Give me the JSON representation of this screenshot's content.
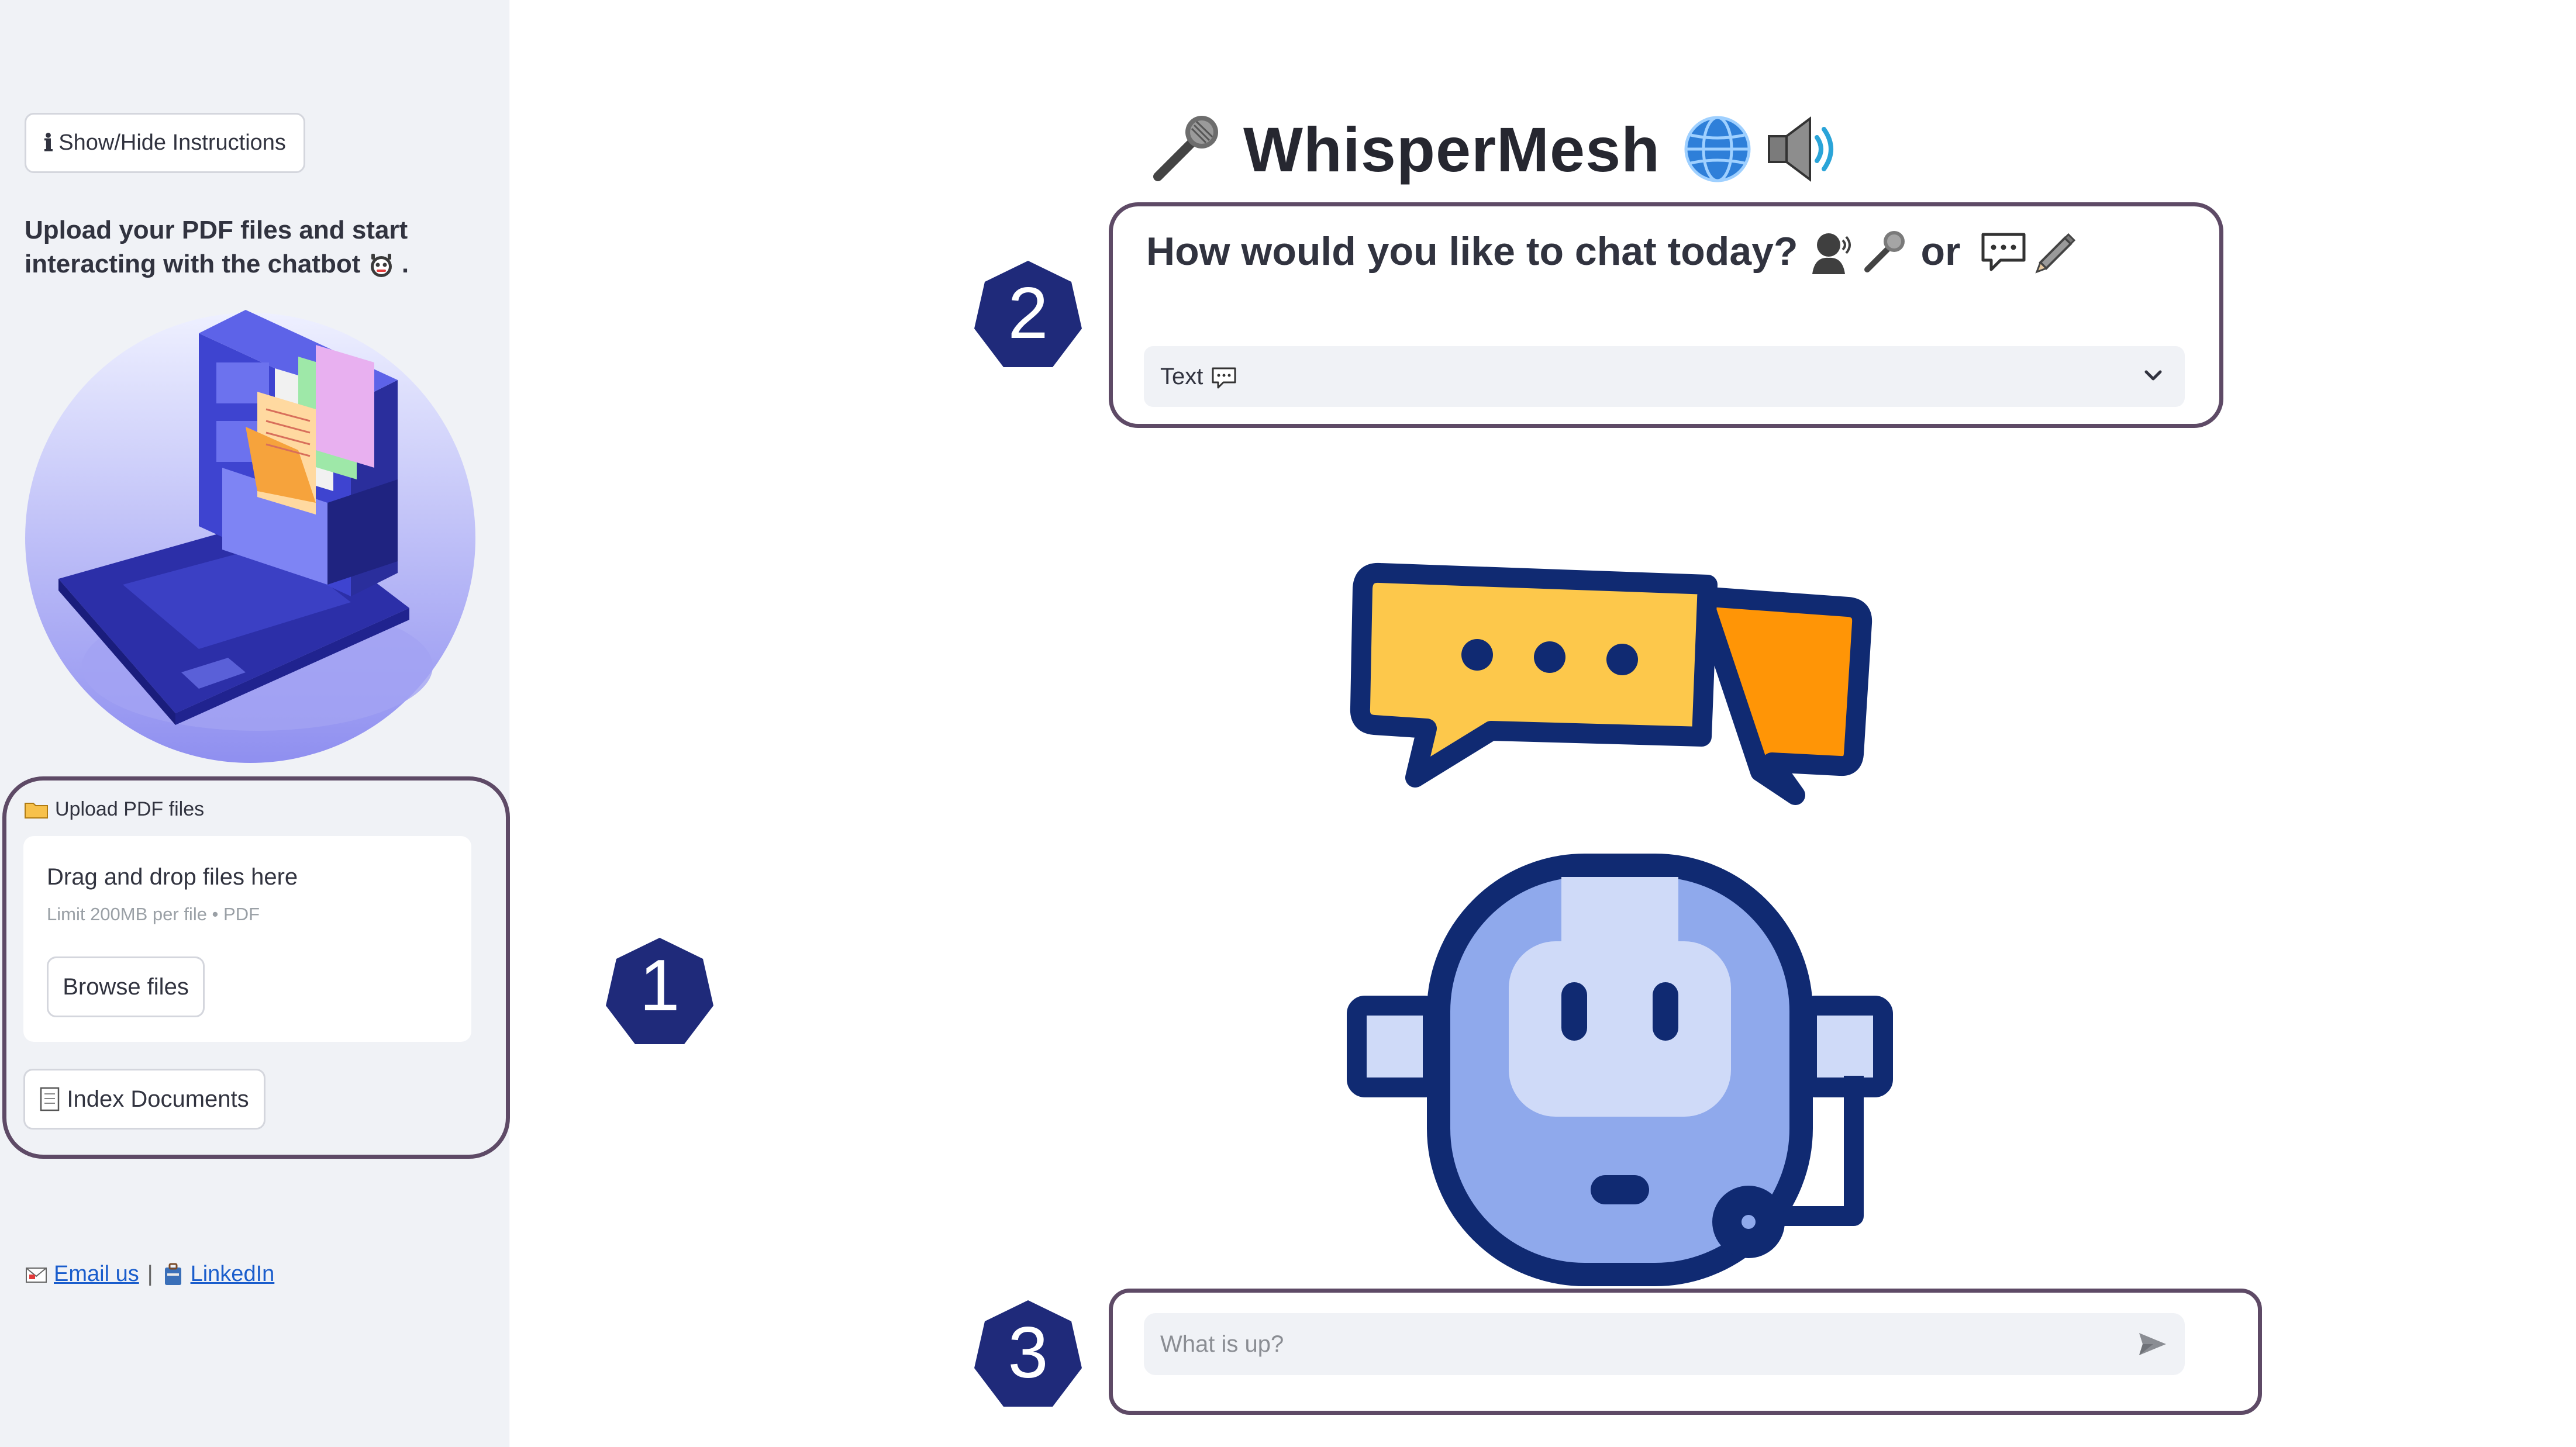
{
  "sidebar": {
    "instructions_button": "Show/Hide Instructions",
    "instructions_icon": "ℹ",
    "intro_text": "Upload your PDF files and start interacting with the chatbot",
    "intro_suffix": ".",
    "upload": {
      "label": "Upload PDF files",
      "dropzone_title": "Drag and drop files here",
      "dropzone_limit": "Limit 200MB per file • PDF",
      "browse_button": "Browse files"
    },
    "index_button": "Index Documents",
    "links": {
      "email": "Email us",
      "separator": "|",
      "linkedin": "LinkedIn"
    }
  },
  "header": {
    "title": "WhisperMesh"
  },
  "chat_mode": {
    "question": "How would you like to chat today?",
    "or_word": "or",
    "selected": "Text"
  },
  "chat_input": {
    "placeholder": "What is up?"
  },
  "markers": {
    "one": "1",
    "two": "2",
    "three": "3"
  },
  "colors": {
    "sidebar_bg": "#f0f2f6",
    "highlight_border": "#5e4a66",
    "marker_fill": "#1f2a7a",
    "robot_navy": "#102a72",
    "robot_blue": "#8fa9ec",
    "bubble_yellow": "#fdc84b",
    "bubble_orange": "#ff9506",
    "link_blue": "#1a5dcc"
  },
  "icons": [
    "info-icon",
    "robot-emoji-icon",
    "folder-icon",
    "document-icon",
    "email-icon",
    "linkedin-icon",
    "microphone-icon",
    "globe-icon",
    "speaker-icon",
    "speaking-head-icon",
    "speech-balloon-icon",
    "pencil-icon",
    "chevron-down-icon",
    "send-icon"
  ]
}
